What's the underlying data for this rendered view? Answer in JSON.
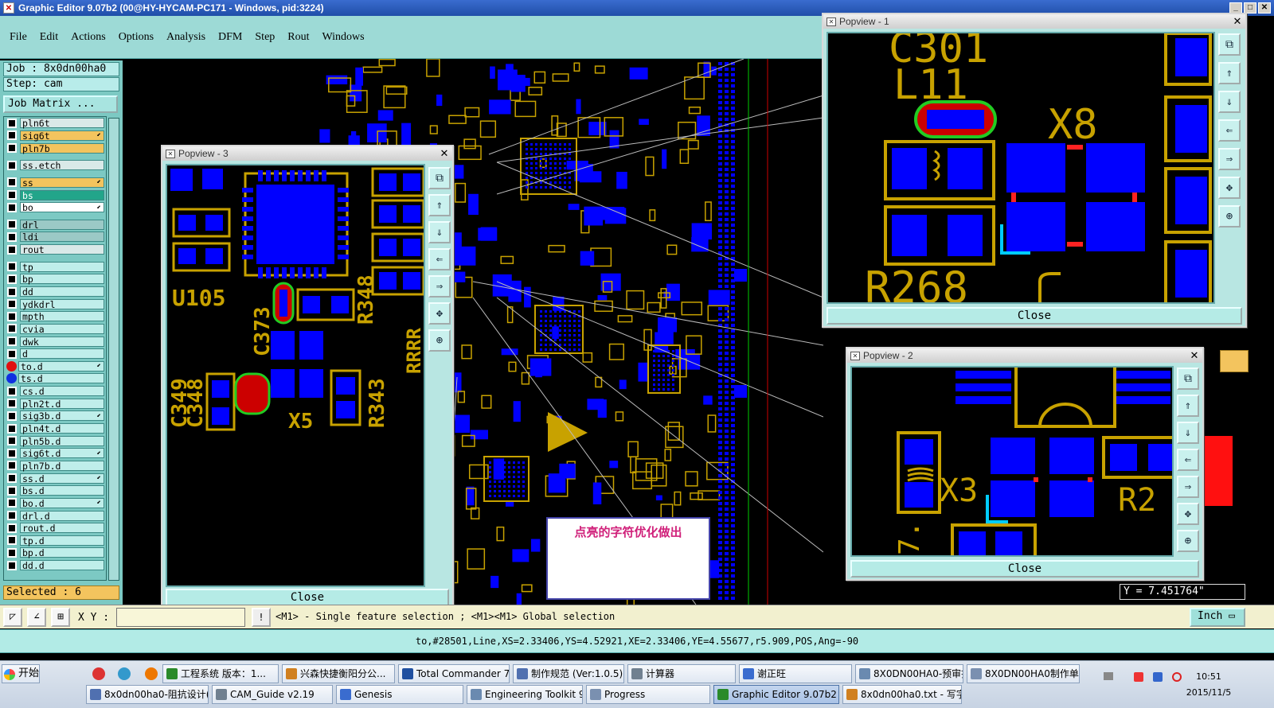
{
  "window": {
    "title": "Graphic Editor 9.07b2 (00@HY-HYCAM-PC171 - Windows, pid:3224)"
  },
  "menu": [
    "File",
    "Edit",
    "Actions",
    "Options",
    "Analysis",
    "DFM",
    "Step",
    "Rout",
    "Windows"
  ],
  "left": {
    "job": "Job : 8x0dn00ha0",
    "step": "Step: cam",
    "job_matrix": "Job Matrix ...",
    "selected": "Selected : 6",
    "layers": [
      {
        "name": "pln6t",
        "style": "lt"
      },
      {
        "name": "sig6t",
        "style": "o",
        "arrow": true
      },
      {
        "name": "pln7b",
        "style": "o"
      },
      {
        "name": "",
        "style": "gap"
      },
      {
        "name": "ss.etch",
        "style": "lt"
      },
      {
        "name": "",
        "style": "gap"
      },
      {
        "name": "ss",
        "style": "o",
        "arrow": true
      },
      {
        "name": "bs",
        "style": "g"
      },
      {
        "name": "bo",
        "style": "w",
        "arrow": true
      },
      {
        "name": "",
        "style": "gap"
      },
      {
        "name": "drl",
        "style": "gr"
      },
      {
        "name": "ldi",
        "style": "gr"
      },
      {
        "name": "rout",
        "style": "lt"
      },
      {
        "name": "",
        "style": "gap"
      },
      {
        "name": "tp",
        "style": ""
      },
      {
        "name": "bp",
        "style": ""
      },
      {
        "name": "dd",
        "style": ""
      },
      {
        "name": "ydkdrl",
        "style": ""
      },
      {
        "name": "mpth",
        "style": ""
      },
      {
        "name": "cvia",
        "style": ""
      },
      {
        "name": "dwk",
        "style": ""
      },
      {
        "name": "d",
        "style": ""
      },
      {
        "name": "to.d",
        "style": "",
        "dot": "#e01010",
        "arrow": true
      },
      {
        "name": "ts.d",
        "style": "",
        "dot": "#1030e0"
      },
      {
        "name": "cs.d",
        "style": ""
      },
      {
        "name": "pln2t.d",
        "style": ""
      },
      {
        "name": "sig3b.d",
        "style": "",
        "arrow": true
      },
      {
        "name": "pln4t.d",
        "style": ""
      },
      {
        "name": "pln5b.d",
        "style": ""
      },
      {
        "name": "sig6t.d",
        "style": "",
        "arrow": true
      },
      {
        "name": "pln7b.d",
        "style": ""
      },
      {
        "name": "ss.d",
        "style": "",
        "arrow": true
      },
      {
        "name": "bs.d",
        "style": ""
      },
      {
        "name": "bo.d",
        "style": "",
        "arrow": true
      },
      {
        "name": "drl.d",
        "style": ""
      },
      {
        "name": "rout.d",
        "style": ""
      },
      {
        "name": "tp.d",
        "style": ""
      },
      {
        "name": "bp.d",
        "style": ""
      },
      {
        "name": "dd.d",
        "style": ""
      }
    ]
  },
  "pop1": {
    "title": "Popview - 1",
    "close": "Close",
    "labels": {
      "a": "C301",
      "b": "L11",
      "c": "X8",
      "d": "R268"
    }
  },
  "pop2": {
    "title": "Popview - 2",
    "close": "Close",
    "labels": {
      "a": "X3",
      "b": "R2",
      "c": "7."
    }
  },
  "pop3": {
    "title": "Popview - 3",
    "close": "Close",
    "labels": {
      "u": "U105",
      "c373": "C373",
      "r348": "R348",
      "c349": "C349",
      "c348": "C348",
      "x5": "X5",
      "r343": "R343",
      "rrr": "RRRR"
    }
  },
  "annotation": "点亮的字符优化做出",
  "ycoord": "Y = 7.451764\"",
  "cmd": {
    "xy_label": "X Y :",
    "xy_value": "",
    "hint": "<M1> - Single feature selection ; <M1><M1> Global selection",
    "unit": "Inch"
  },
  "status": "to,#28501,Line,XS=2.33406,YS=4.52921,XE=2.33406,YE=4.55677,r5.909,POS,Ang=-90",
  "taskbar": {
    "start": "开始",
    "row1": [
      "工程系统  版本：1...",
      "兴森快捷衡阳分公...",
      "Total Commander 7.0...",
      "制作规范 (Ver:1.0.5)",
      "计算器",
      "谢正旺",
      "8X0DN00HA0-预审指...",
      "8X0DN00HA0制作单..."
    ],
    "row2": [
      "8x0dn00ha0-阻抗设计(...",
      "CAM_Guide v2.19",
      "Genesis",
      "Engineering Toolkit 9.07...",
      "Progress",
      "Graphic Editor 9.07b2 ...",
      "8x0dn00ha0.txt - 写字板"
    ],
    "clock_time": "10:51",
    "clock_date": "2015/11/5"
  },
  "colors": {
    "pcb_bg": "#000000",
    "copper": "#c8a200",
    "pad": "#0000ff",
    "panel": "#7cc9c3",
    "menu": "#9ddad6"
  }
}
